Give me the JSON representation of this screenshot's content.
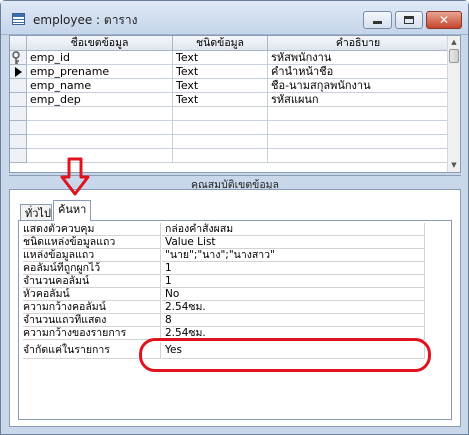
{
  "window": {
    "title": "employee : ตาราง",
    "controls": {
      "minimize": "",
      "maximize": "",
      "close": "✕"
    }
  },
  "grid": {
    "headers": [
      "ชื่อเขตข้อมูล",
      "ชนิดข้อมูล",
      "คำอธิบาย"
    ],
    "rows": [
      {
        "selector": "key-icon",
        "name": "emp_id",
        "type": "Text",
        "desc": "รหัสพนักงาน"
      },
      {
        "selector": "current-row-arrow-icon",
        "name": "emp_prename",
        "type": "Text",
        "desc": "คำนำหน้าชื่อ"
      },
      {
        "selector": "",
        "name": "emp_name",
        "type": "Text",
        "desc": "ชื่อ-นามสกุลพนักงาน"
      },
      {
        "selector": "",
        "name": "emp_dep",
        "type": "Text",
        "desc": "รหัสแผนก"
      }
    ]
  },
  "properties": {
    "section_title": "คุณสมบัติเขตข้อมูล",
    "tabs": [
      "ทั่วไป",
      "ค้นหา"
    ],
    "active_tab": "ค้นหา",
    "rows": [
      {
        "label": "แสดงตัวควบคุม",
        "value": "กล่องคำสั่งผสม"
      },
      {
        "label": "ชนิดแหล่งข้อมูลแถว",
        "value": "Value List"
      },
      {
        "label": "แหล่งข้อมูลแถว",
        "value": "\"นาย\";\"นาง\";\"นางสาว\""
      },
      {
        "label": "คอลัมน์ที่ถูกผูกไว้",
        "value": "1"
      },
      {
        "label": "จำนวนคอลัมน์",
        "value": "1"
      },
      {
        "label": "หัวคอลัมน์",
        "value": "No"
      },
      {
        "label": "ความกว้างคอลัมน์",
        "value": "2.54ซม."
      },
      {
        "label": "จำนวนแถวที่แสดง",
        "value": "8"
      },
      {
        "label": "ความกว้างของรายการ",
        "value": "2.54ซม."
      },
      {
        "label": "จำกัดแค่ในรายการ",
        "value": "Yes"
      }
    ]
  },
  "annotations": {
    "arrow_color": "#e0141e",
    "highlight_color": "#e0141e"
  }
}
